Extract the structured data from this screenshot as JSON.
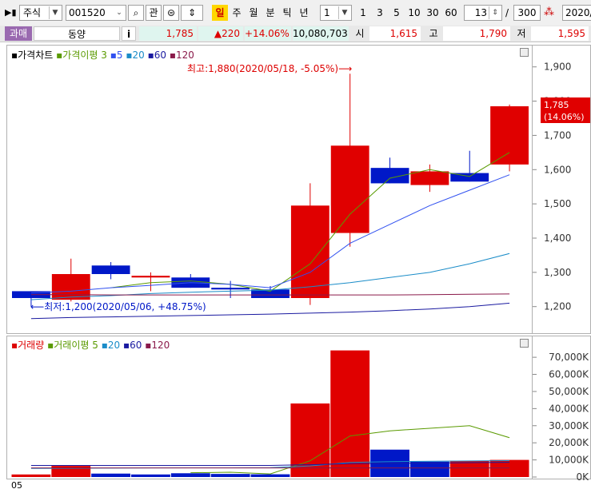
{
  "toolbar": {
    "market_label": "주식",
    "stock_code": "001520",
    "favorite_label": "관",
    "periods": [
      "일",
      "주",
      "월",
      "분",
      "틱",
      "년"
    ],
    "selected_period": "일",
    "interval_select": "1",
    "intervals": [
      "1",
      "3",
      "5",
      "10",
      "30",
      "60"
    ],
    "zoom_value": "13",
    "slash": "/",
    "total_count": "300",
    "date_value": "2020/"
  },
  "quote": {
    "tag": "과매",
    "name": "동양",
    "info_icon": "i",
    "price": "1,785",
    "change": "▲220",
    "change_pct": "+14.06%",
    "volume": "10,080,703",
    "open_label": "시",
    "open": "1,615",
    "high_label": "고",
    "high": "1,790",
    "low_label": "저",
    "low": "1,595"
  },
  "colors": {
    "up": "#e00000",
    "down": "#0018c8",
    "ma3": "#5a9a00",
    "ma5": "#3050f0",
    "ma20": "#1a8cc8",
    "ma60": "#1a1aa0",
    "ma120": "#8a1a4a"
  },
  "price_panel": {
    "legend": {
      "title": "가격차트",
      "ma_title": "가격이평",
      "ma_periods": [
        "3",
        "5",
        "20",
        "60",
        "120"
      ]
    },
    "max_annotation": "최고:1,880(2020/05/18, -5.05%)⟶",
    "min_annotation": "⟵최저:1,200(2020/05/06, +48.75%)",
    "last_price_label": "1,785",
    "last_pct_label": "(14.06%)"
  },
  "volume_panel": {
    "legend": {
      "title": "거래량",
      "ma_title": "거래이평",
      "ma_periods": [
        "5",
        "20",
        "60",
        "120"
      ]
    }
  },
  "bottom_label": "05",
  "chart_data": [
    {
      "type": "candlestick",
      "title": "가격차트",
      "ylim": [
        1120,
        1960
      ],
      "yticks": [
        "1,900",
        "1,800",
        "1,700",
        "1,600",
        "1,500",
        "1,400",
        "1,300",
        "1,200"
      ],
      "ytick_values": [
        1900,
        1800,
        1700,
        1600,
        1500,
        1400,
        1300,
        1200
      ],
      "candles": [
        {
          "open": 1245,
          "high": 1240,
          "low": 1200,
          "close": 1225,
          "dir": "down"
        },
        {
          "open": 1220,
          "high": 1340,
          "low": 1215,
          "close": 1295,
          "dir": "up"
        },
        {
          "open": 1320,
          "high": 1330,
          "low": 1280,
          "close": 1295,
          "dir": "down"
        },
        {
          "open": 1285,
          "high": 1300,
          "low": 1245,
          "close": 1290,
          "dir": "up"
        },
        {
          "open": 1285,
          "high": 1295,
          "low": 1255,
          "close": 1255,
          "dir": "down"
        },
        {
          "open": 1255,
          "high": 1275,
          "low": 1225,
          "close": 1250,
          "dir": "down"
        },
        {
          "open": 1250,
          "high": 1260,
          "low": 1225,
          "close": 1225,
          "dir": "down"
        },
        {
          "open": 1225,
          "high": 1560,
          "low": 1205,
          "close": 1495,
          "dir": "up"
        },
        {
          "open": 1415,
          "high": 1880,
          "low": 1375,
          "close": 1670,
          "dir": "up"
        },
        {
          "open": 1605,
          "high": 1635,
          "low": 1560,
          "close": 1560,
          "dir": "down"
        },
        {
          "open": 1555,
          "high": 1615,
          "low": 1535,
          "close": 1595,
          "dir": "up"
        },
        {
          "open": 1590,
          "high": 1655,
          "low": 1565,
          "close": 1565,
          "dir": "down"
        },
        {
          "open": 1615,
          "high": 1790,
          "low": 1595,
          "close": 1785,
          "dir": "up"
        }
      ],
      "series": [
        {
          "name": "3",
          "values": [
            null,
            null,
            1255,
            1270,
            1275,
            1265,
            1245,
            1325,
            1470,
            1575,
            1600,
            1580,
            1650
          ]
        },
        {
          "name": "5",
          "values": [
            1240,
            1245,
            1255,
            1262,
            1270,
            1265,
            1255,
            1300,
            1385,
            1440,
            1495,
            1540,
            1585
          ]
        },
        {
          "name": "20",
          "values": [
            1220,
            1228,
            1232,
            1238,
            1242,
            1245,
            1248,
            1258,
            1270,
            1285,
            1300,
            1325,
            1355
          ]
        },
        {
          "name": "60",
          "values": [
            1165,
            1168,
            1170,
            1172,
            1174,
            1176,
            1178,
            1181,
            1184,
            1188,
            1193,
            1200,
            1210
          ]
        },
        {
          "name": "120",
          "values": [
            1235,
            1235,
            1234,
            1234,
            1234,
            1234,
            1234,
            1234,
            1234,
            1234,
            1235,
            1236,
            1237
          ]
        }
      ]
    },
    {
      "type": "bar",
      "title": "거래량",
      "ylim": [
        0,
        78000
      ],
      "yticks": [
        "70,000K",
        "60,000K",
        "50,000K",
        "40,000K",
        "30,000K",
        "20,000K",
        "10,000K",
        "0K"
      ],
      "ytick_values": [
        70000,
        60000,
        50000,
        40000,
        30000,
        20000,
        10000,
        0
      ],
      "values": [
        1500,
        6500,
        2000,
        1500,
        2200,
        1800,
        1600,
        43000,
        74000,
        16000,
        9000,
        9500,
        10000
      ],
      "dirs": [
        "up",
        "up",
        "down",
        "down",
        "down",
        "down",
        "down",
        "up",
        "up",
        "down",
        "down",
        "up",
        "up"
      ],
      "series": [
        {
          "name": "5",
          "values": [
            null,
            null,
            null,
            null,
            2500,
            2800,
            1800,
            9500,
            24000,
            27000,
            28500,
            30000,
            23000
          ]
        },
        {
          "name": "20",
          "values": [
            5000,
            5100,
            5200,
            5300,
            5400,
            5400,
            5500,
            6500,
            8500,
            9000,
            9200,
            9400,
            9600
          ]
        },
        {
          "name": "60",
          "values": [
            6800,
            6800,
            6800,
            6800,
            6800,
            6800,
            6800,
            7200,
            7800,
            8000,
            8200,
            8400,
            8600
          ]
        },
        {
          "name": "120",
          "values": [
            5300,
            5300,
            5300,
            5300,
            5300,
            5300,
            5300,
            5300,
            5300,
            5300,
            5300,
            5300,
            5300
          ]
        }
      ]
    }
  ]
}
